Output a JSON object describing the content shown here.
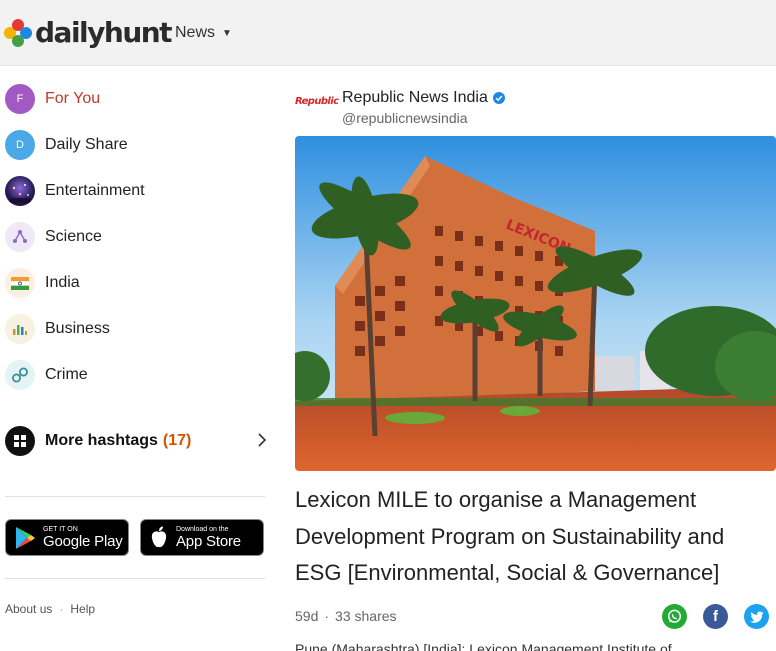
{
  "header": {
    "logo_text": "dailyhunt",
    "nav_label": "News"
  },
  "sidebar": {
    "categories": [
      {
        "label": "For You",
        "icon_letter": "F",
        "icon": "for-you-avatar",
        "color": "#a259c4",
        "active": true
      },
      {
        "label": "Daily Share",
        "icon_letter": "D",
        "icon": "daily-share-avatar",
        "color": "#4aa8e6",
        "active": false
      },
      {
        "label": "Entertainment",
        "icon": "entertainment-icon",
        "active": false
      },
      {
        "label": "Science",
        "icon": "science-icon",
        "active": false
      },
      {
        "label": "India",
        "icon": "india-flag-icon",
        "active": false
      },
      {
        "label": "Business",
        "icon": "business-chart-icon",
        "active": false
      },
      {
        "label": "Crime",
        "icon": "handcuffs-icon",
        "active": false
      }
    ],
    "more_hashtags": {
      "label": "More hashtags",
      "count": "(17)"
    },
    "stores": {
      "google": {
        "small": "GET IT ON",
        "big": "Google Play"
      },
      "apple": {
        "small": "Download on the",
        "big": "App Store"
      }
    },
    "footer": {
      "about": "About us",
      "separator": "·",
      "help": "Help"
    }
  },
  "post": {
    "publisher_logo_text": "Republic",
    "publisher": "Republic News India",
    "handle": "@republicnewsindia",
    "building_sign": "LEXICON",
    "headline": "Lexicon MILE to organise a Management Development Program on Sustainability and ESG [Environmental, Social & Governance]",
    "age": "59d",
    "dot": "·",
    "shares": "33 shares",
    "snippet": "Pune (Maharashtra) [India]: Lexicon Management Institute of",
    "share_buttons": [
      "whatsapp-icon",
      "facebook-icon",
      "twitter-icon"
    ]
  },
  "colors": {
    "accent_active": "#c0392b",
    "hashtag_count": "#d35400",
    "whatsapp": "#25a936",
    "facebook": "#3b5998",
    "twitter": "#1da1f2"
  }
}
